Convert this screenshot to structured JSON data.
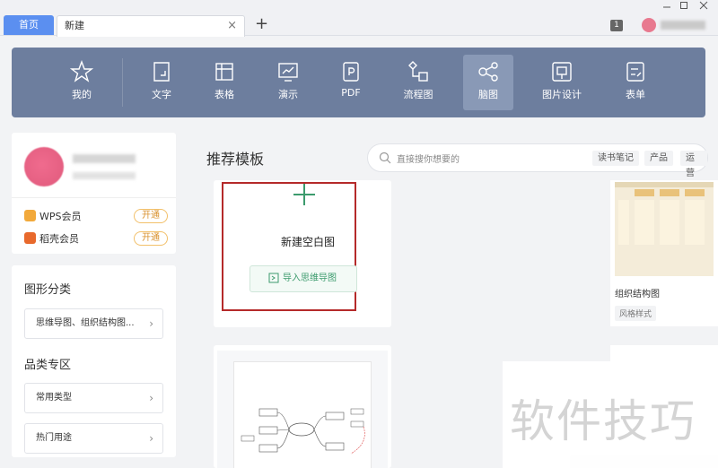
{
  "tabs": {
    "home_label": "首页",
    "active_label": "新建",
    "close_symbol": "×",
    "add_symbol": "+"
  },
  "window": {
    "notification_count": "1"
  },
  "toolbar": {
    "items": [
      {
        "label": "我的",
        "icon": "star-icon"
      },
      {
        "label": "文字",
        "icon": "document-icon"
      },
      {
        "label": "表格",
        "icon": "table-icon"
      },
      {
        "label": "演示",
        "icon": "presentation-icon"
      },
      {
        "label": "PDF",
        "icon": "pdf-icon"
      },
      {
        "label": "流程图",
        "icon": "flowchart-icon"
      },
      {
        "label": "脑图",
        "icon": "mindmap-icon",
        "active": true
      },
      {
        "label": "图片设计",
        "icon": "image-design-icon"
      },
      {
        "label": "表单",
        "icon": "form-icon"
      }
    ]
  },
  "sidebar": {
    "members": [
      {
        "label": "WPS会员",
        "button": "开通",
        "color": "#f2a93b"
      },
      {
        "label": "稻壳会员",
        "button": "开通",
        "color": "#e8692c"
      }
    ],
    "category_title": "图形分类",
    "category_button": "思维导图、组织结构图...",
    "zone_title": "品类专区",
    "zone_buttons": [
      "常用类型",
      "热门用途"
    ]
  },
  "main": {
    "section_title": "推荐模板",
    "search_placeholder": "直接搜你想要的",
    "search_tags": [
      "读书笔记",
      "产品",
      "运营"
    ],
    "blank_card_label": "新建空白图",
    "import_button": "导入思维导图",
    "org_card_label": "组织结构图",
    "org_card_tag": "风格样式"
  },
  "watermark": "软件技巧",
  "colors": {
    "toolbar_bg": "#6d7e9e",
    "home_tab": "#5b8ff0",
    "highlight_frame": "#b52a2a",
    "accent_green": "#3c9b6d"
  }
}
